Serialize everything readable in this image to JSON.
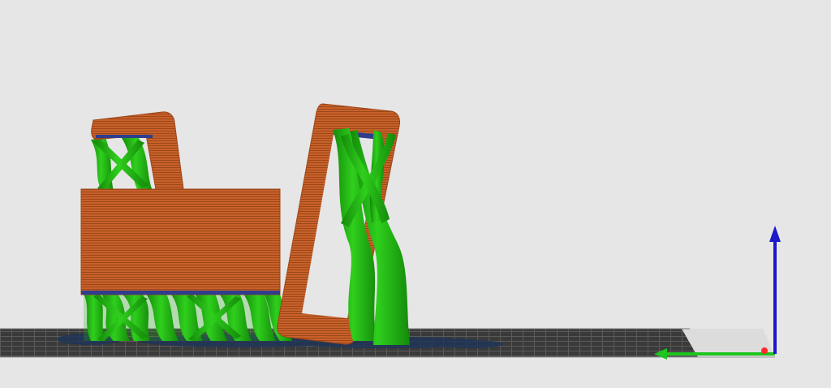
{
  "viewport": {
    "background": "#e6e6e6"
  },
  "colors": {
    "model": "#c8612a",
    "model_dark": "#9c4619",
    "model_light": "#e08a52",
    "support": "#22b814",
    "support_dark": "#148a0a",
    "support_interface": "#2f3d8c",
    "bed": "#3a3a3a",
    "bed_grid": "#6c6c6c",
    "bed_edge": "#d8d8d8",
    "shadow": "#1f3557",
    "axis_x": "#ff2a2a",
    "axis_y": "#1fc41f",
    "axis_z": "#1a18c8"
  },
  "icons": {
    "axis_gizmo": "axis-gizmo-icon"
  }
}
